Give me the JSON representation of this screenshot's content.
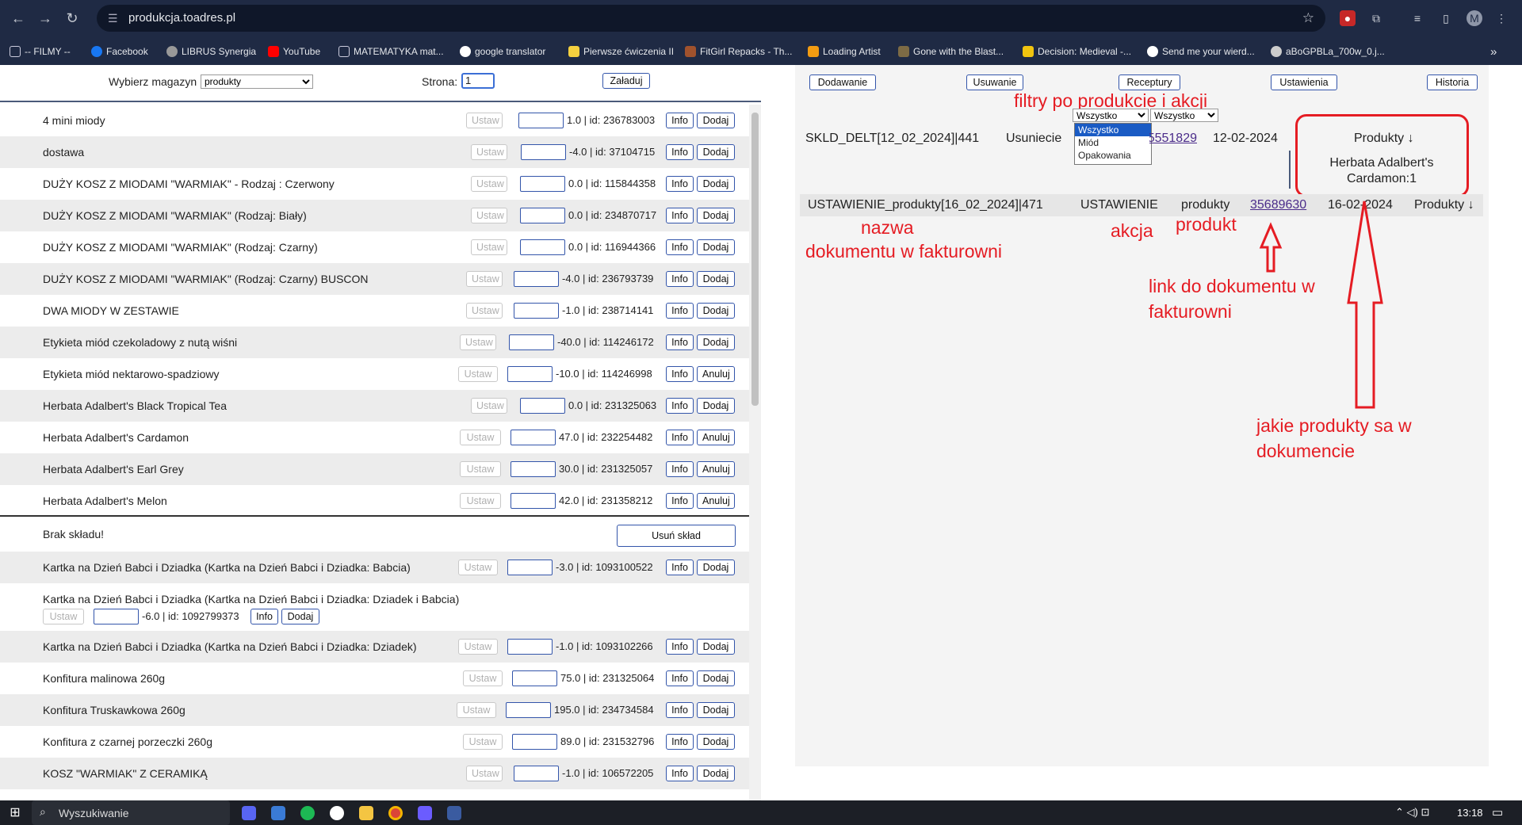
{
  "browser": {
    "url": "produkcja.toadres.pl",
    "bookmarks": [
      "-- FILMY --",
      "Facebook",
      "LIBRUS Synergia",
      "YouTube",
      "MATEMATYKA mat...",
      "google translator",
      "Pierwsze ćwiczenia II",
      "FitGirl Repacks - Th...",
      "Loading Artist",
      "Gone with the Blast...",
      "Decision: Medieval -...",
      "Send me your wierd...",
      "aBoGPBLa_700w_0.j..."
    ],
    "avatar_letter": "M"
  },
  "left": {
    "warehouse_label": "Wybierz magazyn",
    "warehouse_value": "produkty",
    "page_label": "Strona:",
    "page_value": "1",
    "load_button": "Załaduj",
    "set_label": "Ustaw",
    "info_label": "Info",
    "items": [
      {
        "name": "4 mini miody",
        "value": "1.0 | id: 236783003",
        "action": "Dodaj"
      },
      {
        "name": "dostawa",
        "value": "-4.0 | id: 37104715",
        "action": "Dodaj"
      },
      {
        "name": "DUŻY KOSZ Z MIODAMI \"WARMIAK\" - Rodzaj : Czerwony",
        "value": "0.0 | id: 115844358",
        "action": "Dodaj"
      },
      {
        "name": "DUŻY KOSZ Z MIODAMI \"WARMIAK\" (Rodzaj: Biały)",
        "value": "0.0 | id: 234870717",
        "action": "Dodaj"
      },
      {
        "name": "DUŻY KOSZ Z MIODAMI \"WARMIAK\" (Rodzaj: Czarny)",
        "value": "0.0 | id: 116944366",
        "action": "Dodaj"
      },
      {
        "name": "DUŻY KOSZ Z MIODAMI \"WARMIAK\" (Rodzaj: Czarny) BUSCON",
        "value": "-4.0 | id: 236793739",
        "action": "Dodaj"
      },
      {
        "name": "DWA MIODY W ZESTAWIE",
        "value": "-1.0 | id: 238714141",
        "action": "Dodaj"
      },
      {
        "name": "Etykieta miód czekoladowy z nutą wiśni",
        "value": "-40.0 | id: 114246172",
        "action": "Dodaj"
      },
      {
        "name": "Etykieta miód nektarowo-spadziowy",
        "value": "-10.0 | id: 114246998",
        "action": "Anuluj"
      },
      {
        "name": "Herbata Adalbert's Black Tropical Tea",
        "value": "0.0 | id: 231325063",
        "action": "Dodaj"
      },
      {
        "name": "Herbata Adalbert's Cardamon",
        "value": "47.0 | id: 232254482",
        "action": "Anuluj"
      },
      {
        "name": "Herbata Adalbert's Earl Grey",
        "value": "30.0 | id: 231325057",
        "action": "Anuluj"
      },
      {
        "name": "Herbata Adalbert's Melon",
        "value": "42.0 | id: 231358212",
        "action": "Anuluj"
      }
    ],
    "missing_composition": "Brak składu!",
    "remove_composition": "Usuń skład",
    "items2": [
      {
        "name": "Kartka na Dzień Babci i Dziadka (Kartka na Dzień Babci i Dziadka: Babcia)",
        "value": "-3.0 | id: 1093100522",
        "action": "Dodaj"
      },
      {
        "name": "Kartka na Dzień Babci i Dziadka (Kartka na Dzień Babci i Dziadka: Dziadek i Babcia)",
        "value": "-6.0 | id: 1092799373",
        "action": "Dodaj"
      },
      {
        "name": "Kartka na Dzień Babci i Dziadka (Kartka na Dzień Babci i Dziadka: Dziadek)",
        "value": "-1.0 | id: 1093102266",
        "action": "Dodaj"
      },
      {
        "name": "Konfitura malinowa 260g",
        "value": "75.0 | id: 231325064",
        "action": "Dodaj"
      },
      {
        "name": "Konfitura Truskawkowa 260g",
        "value": "195.0 | id: 234734584",
        "action": "Dodaj"
      },
      {
        "name": "Konfitura z czarnej porzeczki 260g",
        "value": "89.0 | id: 231532796",
        "action": "Dodaj"
      },
      {
        "name": "KOSZ \"WARMIAK\" Z CERAMIKĄ",
        "value": "-1.0 | id: 106572205",
        "action": "Dodaj"
      }
    ]
  },
  "right": {
    "tabs": [
      "Dodawanie",
      "Usuwanie",
      "Receptury",
      "Ustawienia",
      "Historia"
    ],
    "filter1_value": "Wszystko",
    "filter2_value": "Wszystko",
    "filter_options": [
      "Wszystko",
      "Miód",
      "Opakowania"
    ],
    "row1": {
      "doc": "SKLD_DELT[12_02_2024]|441",
      "action": "Usuniecie",
      "link": "35551829",
      "date": "12-02-2024",
      "products_header": "Produkty ↓",
      "products": "Herbata Adalbert's Cardamon:1"
    },
    "row2": {
      "doc": "USTAWIENIE_produkty[16_02_2024]|471",
      "action": "USTAWIENIE",
      "product": "produkty",
      "link": "35689630",
      "date": "16-02-2024",
      "products_header": "Produkty ↓"
    },
    "annotations": {
      "filters": "filtry po produkcie i akcji",
      "doc_name_1": "nazwa",
      "doc_name_2": "dokumentu w fakturowni",
      "action": "akcja",
      "product": "produkt",
      "link_1": "link do dokumentu w",
      "link_2": "fakturowni",
      "products_1": "jakie produkty sa w",
      "products_2": "dokumencie"
    }
  },
  "taskbar": {
    "search": "Wyszukiwanie",
    "time": "13:18"
  },
  "colors": {
    "annotation": "#e51c23",
    "chrome": "#1f2a44",
    "accent": "#3355aa"
  }
}
